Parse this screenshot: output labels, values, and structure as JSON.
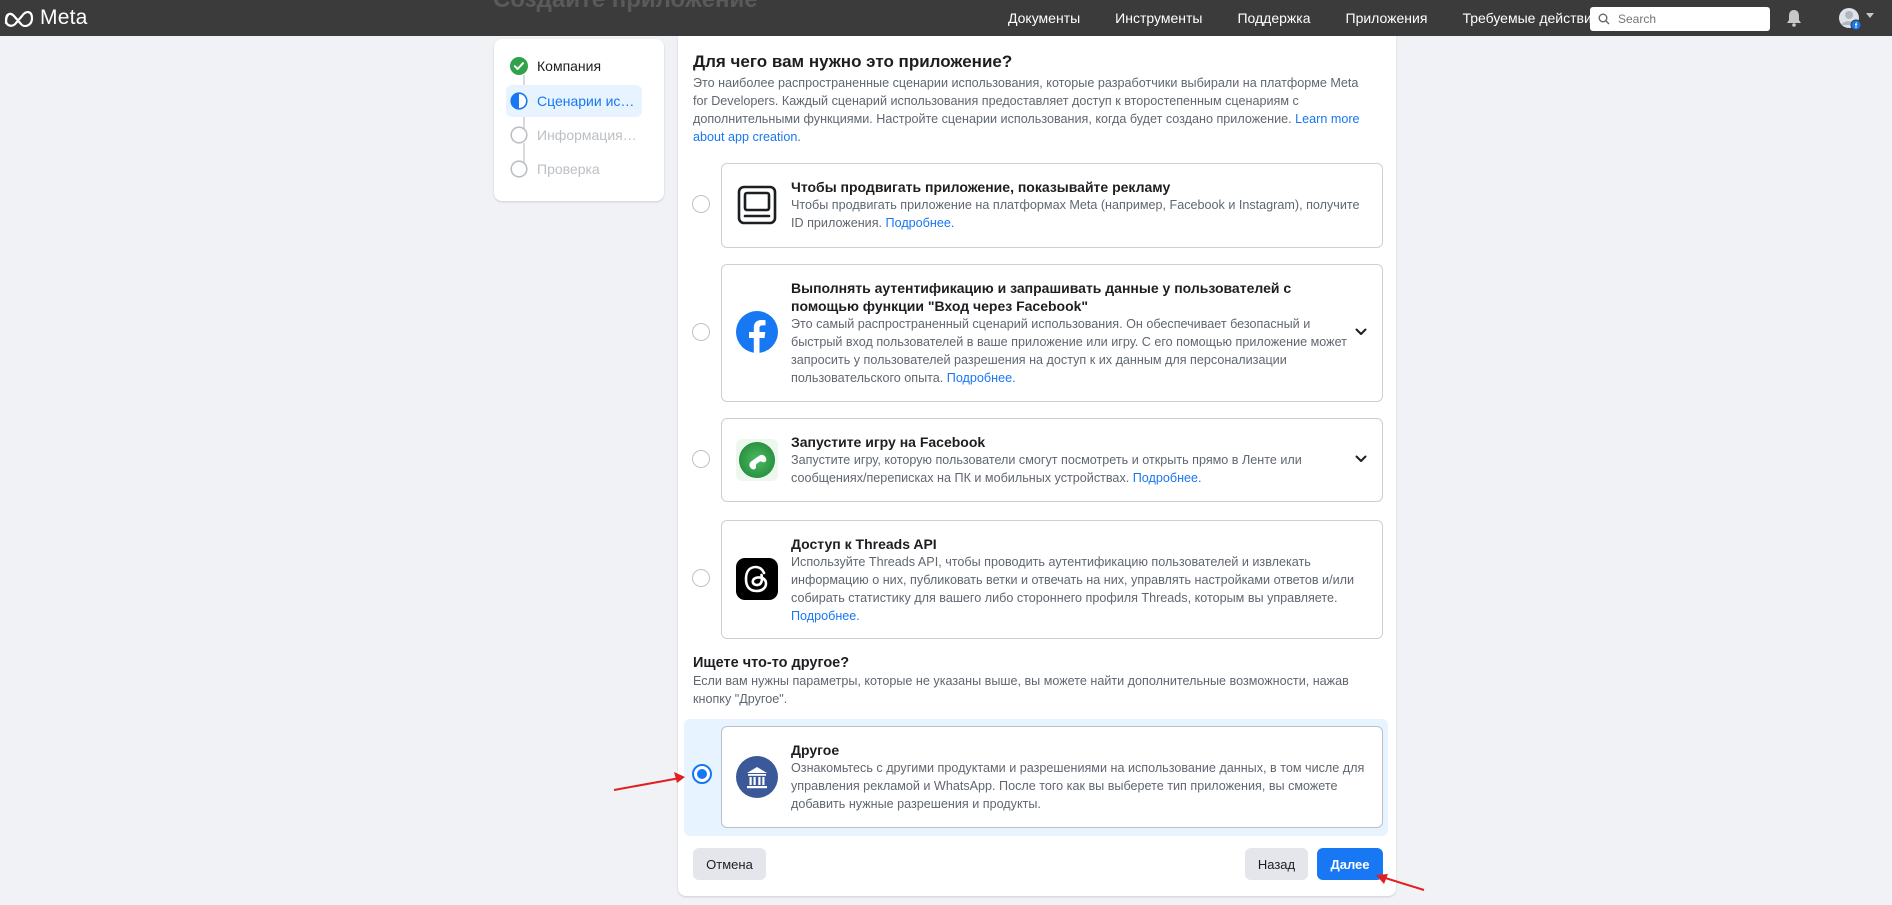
{
  "topbar": {
    "logo_text": "Meta",
    "ghost_title": "Создайте приложение",
    "nav": [
      "Документы",
      "Инструменты",
      "Поддержка",
      "Приложения",
      "Требуемые действия"
    ],
    "search_placeholder": "Search"
  },
  "stepper": {
    "steps": [
      {
        "label": "Компания",
        "state": "done"
      },
      {
        "label": "Сценарии исп...",
        "state": "active"
      },
      {
        "label": "Информация ...",
        "state": "todo"
      },
      {
        "label": "Проверка",
        "state": "todo"
      }
    ]
  },
  "main": {
    "title": "Для чего вам нужно это приложение?",
    "intro": "Это наиболее распространенные сценарии использования, которые разработчики выбирали на платформе Meta for Developers. Каждый сценарий использования предоставляет доступ к второстепенным сценариям с дополнительными функциями. Настройте сценарии использования, когда будет создано приложение.",
    "intro_link": "Learn more about app creation",
    "intro_end": ".",
    "options": [
      {
        "icon": "monitor-icon",
        "title": "Чтобы продвигать приложение, показывайте рекламу",
        "desc": "Чтобы продвигать приложение на платформах Meta (например, Facebook и Instagram), получите ID приложения.",
        "link": "Подробнее.",
        "selected": false,
        "expandable": false
      },
      {
        "icon": "facebook-icon",
        "title": "Выполнять аутентификацию и запрашивать данные у пользователей с помощью функции \"Вход через Facebook\"",
        "desc": "Это самый распространенный сценарий использования. Он обеспечивает безопасный и быстрый вход пользователей в ваше приложение или игру. С его помощью приложение может запросить у пользователей разрешения на доступ к их данным для персонализации пользовательского опыта.",
        "link": "Подробнее.",
        "selected": false,
        "expandable": true
      },
      {
        "icon": "game-controller-icon",
        "title": "Запустите игру на Facebook",
        "desc": "Запустите игру, которую пользователи смогут посмотреть и открыть прямо в Ленте или сообщениях/переписках на ПК и мобильных устройствах.",
        "link": "Подробнее.",
        "selected": false,
        "expandable": true
      },
      {
        "icon": "threads-icon",
        "title": "Доступ к Threads API",
        "desc": "Используйте Threads API, чтобы проводить аутентификацию пользователей и извлекать информацию о них, публиковать ветки и отвечать на них, управлять настройками ответов и/или собирать статистику для вашего либо стороннего профиля Threads, которым вы управляете.",
        "link": "Подробнее.",
        "selected": false,
        "expandable": false
      }
    ],
    "other_heading": "Ищете что-то другое?",
    "other_text": "Если вам нужны параметры, которые не указаны выше, вы можете найти дополнительные возможности, нажав кнопку \"Другое\".",
    "other_option": {
      "icon": "building-icon",
      "title": "Другое",
      "desc": "Ознакомьтесь с другими продуктами и разрешениями на использование данных, в том числе для управления рекламой и WhatsApp. После того как вы выберете тип приложения, вы сможете добавить нужные разрешения и продукты.",
      "selected": true
    },
    "buttons": {
      "cancel": "Отмена",
      "back": "Назад",
      "next": "Далее"
    }
  },
  "colors": {
    "accent": "#1877f2",
    "topbar": "#3b3b3b",
    "annotation_arrow": "#e02020"
  }
}
